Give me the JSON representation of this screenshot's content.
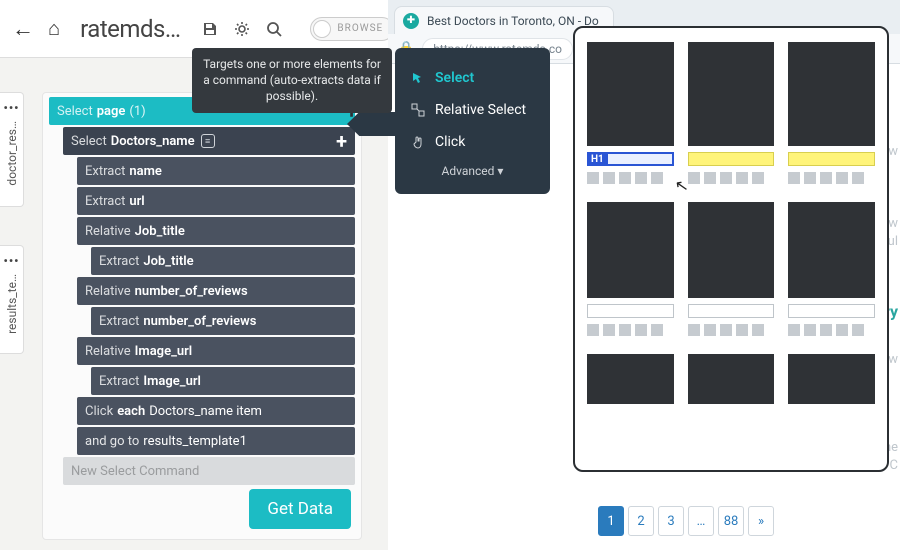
{
  "topbar": {
    "title": "ratemds…",
    "browse_label": "BROWSE"
  },
  "tooltip": {
    "text": "Targets one or more elements for a command (auto-extracts data if possible)."
  },
  "menu": {
    "select": "Select",
    "relative_select": "Relative Select",
    "click": "Click",
    "advanced": "Advanced"
  },
  "side_tabs": {
    "t1": "doctor_res…",
    "t2": "results_te…"
  },
  "cmds": {
    "select": "Select",
    "extract": "Extract",
    "relative": "Relative",
    "click": "Click",
    "each": "each",
    "goto_prefix": "and go to"
  },
  "tree": {
    "page": "page",
    "page_count": "(1)",
    "doctors_name": "Doctors_name",
    "name": "name",
    "url": "url",
    "job_title": "Job_title",
    "num_reviews": "number_of_reviews",
    "image_url": "Image_url",
    "click_target": "Doctors_name item",
    "goto_target": "results_template1",
    "new_cmd": "New Select Command"
  },
  "getdata": "Get Data",
  "browser": {
    "tab_title": "Best Doctors in Toronto, ON - Do",
    "url": "https://www.ratemds.co"
  },
  "preview": {
    "badge": "H1"
  },
  "pagination": {
    "p1": "1",
    "p2": "2",
    "p3": "3",
    "ellipsis": "…",
    "last": "88",
    "next": "»"
  },
  "ghost": {
    "g1": "iew",
    "g2": "e w",
    "g3": "oul",
    "g4": "ry",
    "g5": "iew",
    "g6": "me",
    "g7": "Dr C"
  }
}
